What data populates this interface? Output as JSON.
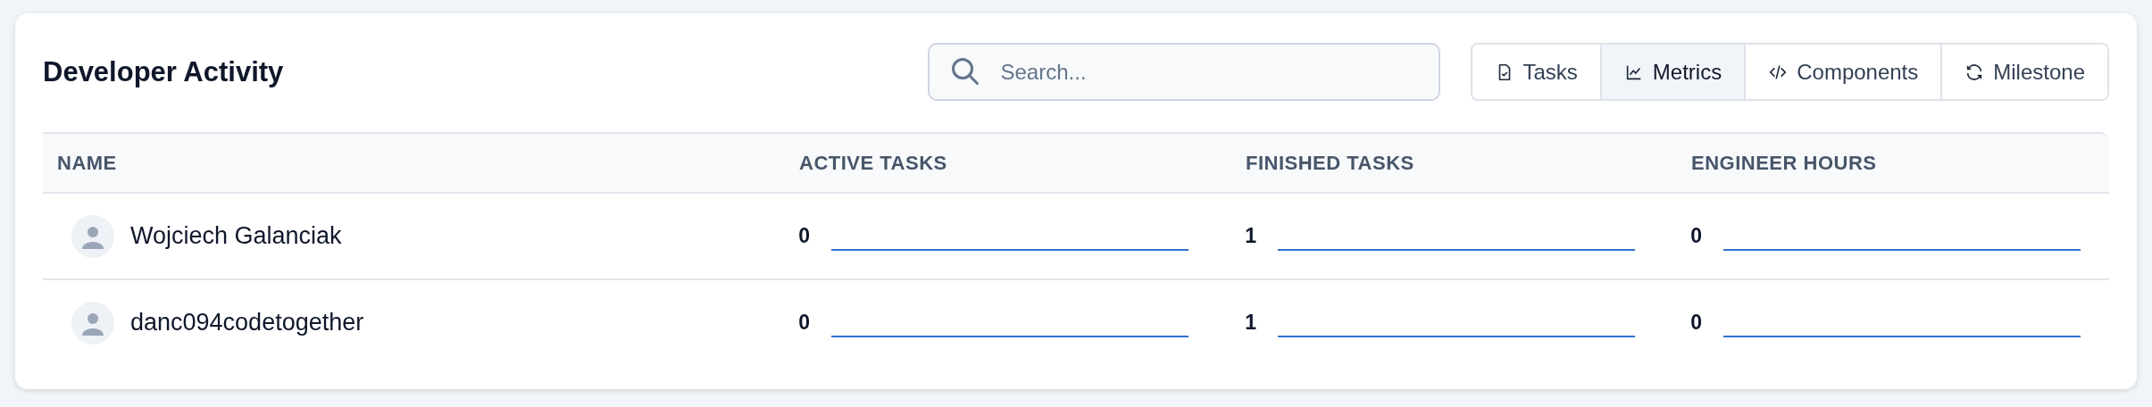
{
  "title": "Developer Activity",
  "search": {
    "placeholder": "Search..."
  },
  "tabs": [
    {
      "label": "Tasks",
      "selected": false
    },
    {
      "label": "Metrics",
      "selected": true
    },
    {
      "label": "Components",
      "selected": false
    },
    {
      "label": "Milestone",
      "selected": false
    }
  ],
  "table": {
    "columns": [
      "NAME",
      "ACTIVE TASKS",
      "FINISHED TASKS",
      "ENGINEER HOURS"
    ],
    "rows": [
      {
        "name": "Wojciech Galanciak",
        "active_tasks": "0",
        "finished_tasks": "1",
        "engineer_hours": "0"
      },
      {
        "name": "danc094codetogether",
        "active_tasks": "0",
        "finished_tasks": "1",
        "engineer_hours": "0"
      }
    ]
  }
}
